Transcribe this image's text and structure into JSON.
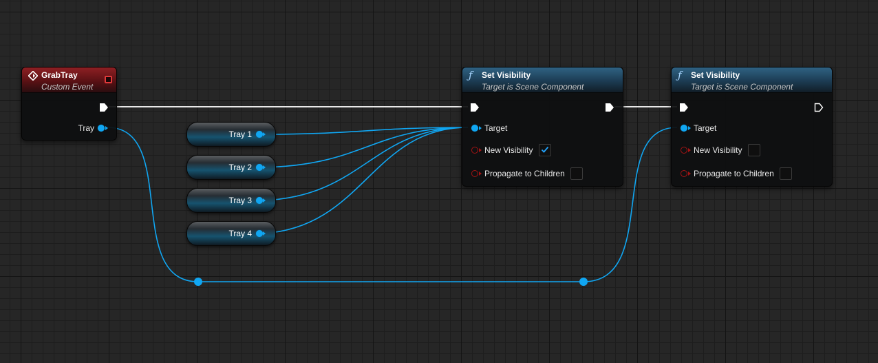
{
  "colors": {
    "canvas": "#262626",
    "event_header": "#8e1f23",
    "function_header": "#2f6283",
    "object_pin": "#10a6f2",
    "bool_pin": "#a31414",
    "exec_wire": "#ffffff"
  },
  "event_node": {
    "title": "GrabTray",
    "subtitle": "Custom Event",
    "icon": "event-diamond-icon",
    "delegate_icon": "delegate-square-icon",
    "output_pin_label": "Tray"
  },
  "variable_nodes": [
    {
      "label": "Tray 1"
    },
    {
      "label": "Tray 2"
    },
    {
      "label": "Tray 3"
    },
    {
      "label": "Tray 4"
    }
  ],
  "function_nodes": [
    {
      "title": "Set Visibility",
      "subtitle": "Target is Scene Component",
      "icon": "function-f-icon",
      "pins": {
        "target": "Target",
        "new_visibility": "New Visibility",
        "propagate": "Propagate to Children"
      },
      "new_visibility_checked": true,
      "propagate_checked": false,
      "exec_out_connected": true
    },
    {
      "title": "Set Visibility",
      "subtitle": "Target is Scene Component",
      "icon": "function-f-icon",
      "pins": {
        "target": "Target",
        "new_visibility": "New Visibility",
        "propagate": "Propagate to Children"
      },
      "new_visibility_checked": false,
      "propagate_checked": false,
      "exec_out_connected": false
    }
  ]
}
